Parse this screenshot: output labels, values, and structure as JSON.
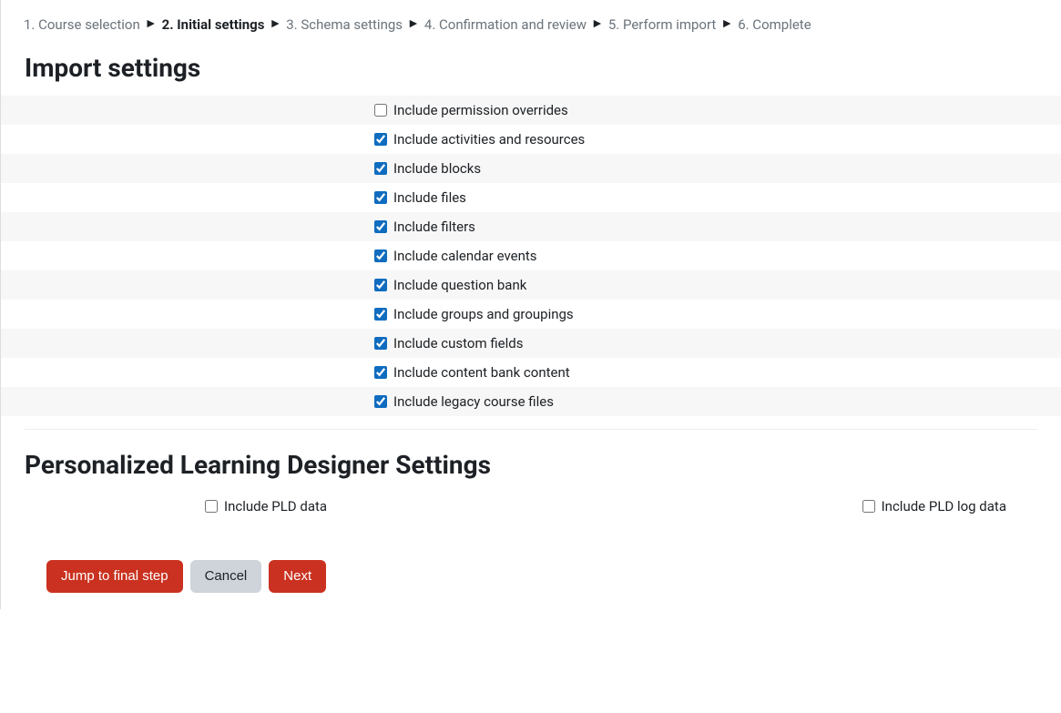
{
  "breadcrumb": {
    "steps": [
      {
        "label": "1. Course selection",
        "current": false
      },
      {
        "label": "2. Initial settings",
        "current": true
      },
      {
        "label": "3. Schema settings",
        "current": false
      },
      {
        "label": "4. Confirmation and review",
        "current": false
      },
      {
        "label": "5. Perform import",
        "current": false
      },
      {
        "label": "6. Complete",
        "current": false
      }
    ]
  },
  "headings": {
    "import_settings": "Import settings",
    "pld_settings": "Personalized Learning Designer Settings"
  },
  "settings": [
    {
      "id": "include-permission-overrides",
      "label": "Include permission overrides",
      "checked": false
    },
    {
      "id": "include-activities-resources",
      "label": "Include activities and resources",
      "checked": true
    },
    {
      "id": "include-blocks",
      "label": "Include blocks",
      "checked": true
    },
    {
      "id": "include-files",
      "label": "Include files",
      "checked": true
    },
    {
      "id": "include-filters",
      "label": "Include filters",
      "checked": true
    },
    {
      "id": "include-calendar-events",
      "label": "Include calendar events",
      "checked": true
    },
    {
      "id": "include-question-bank",
      "label": "Include question bank",
      "checked": true
    },
    {
      "id": "include-groups-groupings",
      "label": "Include groups and groupings",
      "checked": true
    },
    {
      "id": "include-custom-fields",
      "label": "Include custom fields",
      "checked": true
    },
    {
      "id": "include-content-bank",
      "label": "Include content bank content",
      "checked": true
    },
    {
      "id": "include-legacy-files",
      "label": "Include legacy course files",
      "checked": true
    }
  ],
  "pld": {
    "data": {
      "id": "include-pld-data",
      "label": "Include PLD data",
      "checked": false
    },
    "log_data": {
      "id": "include-pld-log",
      "label": "Include PLD log data",
      "checked": false
    }
  },
  "buttons": {
    "jump": "Jump to final step",
    "cancel": "Cancel",
    "next": "Next"
  }
}
